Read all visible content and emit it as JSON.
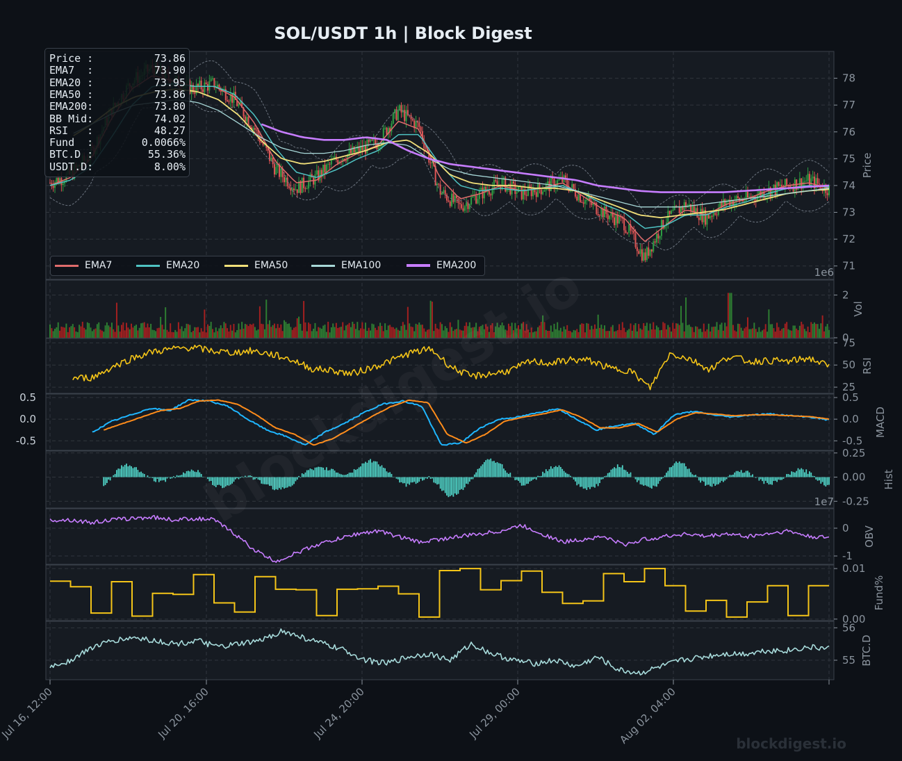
{
  "title": "SOL/USDT  1h  |  Block Digest",
  "watermark": "blockdigest.io",
  "footer_brand": "blockdigest.io",
  "info": [
    {
      "label": "Price :",
      "value": "73.86"
    },
    {
      "label": "EMA7  :",
      "value": "73.90"
    },
    {
      "label": "EMA20 :",
      "value": "73.95"
    },
    {
      "label": "EMA50 :",
      "value": "73.86"
    },
    {
      "label": "EMA200:",
      "value": "73.80"
    },
    {
      "label": "BB Mid:",
      "value": "74.02"
    },
    {
      "label": "RSI   :",
      "value": "48.27"
    },
    {
      "label": "Fund  :",
      "value": "0.0066%"
    },
    {
      "label": "BTC.D :",
      "value": "55.36%"
    },
    {
      "label": "USDT.D:",
      "value": "8.00%"
    }
  ],
  "legend": [
    {
      "name": "EMA7",
      "color": "#e06c6c"
    },
    {
      "name": "EMA20",
      "color": "#4fc3c3"
    },
    {
      "name": "EMA50",
      "color": "#f2e07a"
    },
    {
      "name": "EMA100",
      "color": "#a8d8d8"
    },
    {
      "name": "EMA200",
      "color": "#c77dff"
    }
  ],
  "colors": {
    "background": "#0d1117",
    "panel": "#161b22",
    "up": "#2ea043",
    "down": "#e05555",
    "rsi": "#f5c518",
    "macd": "#1fb6ff",
    "signal": "#ff8c1a",
    "hist": "#4fd1c5",
    "obv": "#c77dff",
    "fund": "#f5c518",
    "btcd": "#a8dcdc",
    "grid": "#30363d"
  },
  "chart_data": {
    "type": "line",
    "symbol": "SOL/USDT",
    "interval": "1h",
    "x_ticks": [
      "Jul 16, 12:00",
      "Jul 20, 16:00",
      "Jul 24, 20:00",
      "Jul 29, 00:00",
      "Aug 02, 04:00"
    ],
    "x_range": [
      "Jul 16, 12:00",
      "Aug 06, 08:00"
    ],
    "panels": [
      {
        "name": "price",
        "ylabel": "Price",
        "ylim": [
          70.5,
          79.0
        ],
        "yticks": [
          "71",
          "72",
          "73",
          "74",
          "75",
          "76",
          "77",
          "78"
        ],
        "series": [
          {
            "name": "Close",
            "values": [
              74.1,
              74.4,
              75.2,
              76.8,
              77.9,
              78.4,
              77.9,
              77.6,
              77.8,
              77.2,
              76.1,
              74.6,
              73.9,
              74.3,
              75.0,
              75.3,
              75.6,
              76.8,
              76.2,
              73.8,
              73.2,
              73.7,
              74.1,
              73.7,
              73.9,
              74.2,
              73.5,
              73.0,
              72.6,
              71.3,
              72.7,
              73.3,
              72.8,
              73.4,
              73.5,
              73.8,
              74.0,
              74.2,
              73.86
            ]
          },
          {
            "name": "EMA7",
            "values": [
              74.0,
              74.3,
              75.0,
              76.5,
              77.6,
              78.1,
              77.9,
              77.7,
              77.7,
              77.3,
              76.3,
              74.9,
              74.1,
              74.2,
              74.8,
              75.2,
              75.5,
              76.4,
              76.1,
              74.3,
              73.5,
              73.7,
              74.0,
              73.8,
              73.9,
              74.1,
              73.6,
              73.1,
              72.8,
              71.9,
              72.5,
              73.1,
              72.9,
              73.3,
              73.5,
              73.8,
              74.0,
              74.1,
              73.9
            ]
          },
          {
            "name": "EMA20",
            "values": [
              74.0,
              74.2,
              74.7,
              75.8,
              77.0,
              77.7,
              77.8,
              77.7,
              77.7,
              77.4,
              76.6,
              75.4,
              74.5,
              74.3,
              74.6,
              75.0,
              75.3,
              75.9,
              75.9,
              74.8,
              74.0,
              73.8,
              73.9,
              73.8,
              73.9,
              74.0,
              73.7,
              73.3,
              73.0,
              72.4,
              72.5,
              72.9,
              72.9,
              73.2,
              73.4,
              73.7,
              73.9,
              74.0,
              73.95
            ]
          },
          {
            "name": "EMA50",
            "values": [
              null,
              75.8,
              76.3,
              76.9,
              77.3,
              77.5,
              77.6,
              77.5,
              77.2,
              76.6,
              75.7,
              75.0,
              74.8,
              74.9,
              75.1,
              75.3,
              75.6,
              75.7,
              75.2,
              74.4,
              74.1,
              74.0,
              74.0,
              73.9,
              73.9,
              73.8,
              73.5,
              73.2,
              72.9,
              72.8,
              72.9,
              73.0,
              73.1,
              73.3,
              73.5,
              73.7,
              73.8,
              73.86
            ]
          },
          {
            "name": "EMA100",
            "values": [
              null,
              75.9,
              76.3,
              76.7,
              77.0,
              77.1,
              77.2,
              77.1,
              76.8,
              76.3,
              75.8,
              75.4,
              75.2,
              75.2,
              75.3,
              75.5,
              75.6,
              75.5,
              75.0,
              74.6,
              74.4,
              74.3,
              74.2,
              74.1,
              74.0,
              73.8,
              73.6,
              73.4,
              73.2,
              73.2,
              73.2,
              73.3,
              73.4,
              73.5,
              73.6,
              73.7,
              73.8,
              73.9
            ]
          },
          {
            "name": "EMA200",
            "values": [
              null,
              null,
              null,
              null,
              null,
              null,
              null,
              null,
              null,
              null,
              76.3,
              76.0,
              75.8,
              75.7,
              75.7,
              75.8,
              75.7,
              75.3,
              75.0,
              74.8,
              74.7,
              74.6,
              74.5,
              74.4,
              74.3,
              74.2,
              74.0,
              73.9,
              73.8,
              73.75,
              73.75,
              73.75,
              73.75,
              73.8,
              73.85,
              73.9,
              73.95,
              74.0
            ]
          }
        ]
      },
      {
        "name": "volume",
        "ylabel": "Vol",
        "scale": "1e6",
        "ylim": [
          0,
          2.7
        ],
        "yticks": [
          "0",
          "2"
        ]
      },
      {
        "name": "rsi",
        "ylabel": "RSI",
        "ylim": [
          18,
          80
        ],
        "yticks": [
          "25",
          "50",
          "75"
        ],
        "values": [
          35,
          36,
          48,
          58,
          65,
          68,
          70,
          66,
          64,
          66,
          62,
          56,
          46,
          44,
          40,
          47,
          55,
          64,
          68,
          48,
          37,
          40,
          44,
          54,
          52,
          56,
          55,
          46,
          44,
          24,
          63,
          57,
          45,
          60,
          54,
          55,
          54,
          58,
          48.27
        ]
      },
      {
        "name": "macd",
        "ylabel": "MACD",
        "ylim": [
          -0.72,
          0.58
        ],
        "yticks_left": [
          "-0.5",
          "0.0",
          "0.5"
        ],
        "yticks_right": [
          "-0.5",
          "0.0",
          "0.5"
        ],
        "series": [
          {
            "name": "MACD",
            "values": [
              -0.3,
              -0.05,
              0.1,
              0.25,
              0.2,
              0.45,
              0.42,
              0.3,
              0.0,
              -0.25,
              -0.4,
              -0.6,
              -0.3,
              -0.1,
              0.15,
              0.35,
              0.42,
              0.3,
              -0.6,
              -0.55,
              -0.2,
              0.0,
              0.05,
              0.15,
              0.25,
              0.0,
              -0.25,
              -0.15,
              -0.1,
              -0.35,
              0.1,
              0.18,
              0.1,
              0.05,
              0.1,
              0.12,
              0.08,
              0.05,
              -0.02
            ]
          },
          {
            "name": "Signal",
            "values": [
              -0.25,
              -0.1,
              0.05,
              0.2,
              0.25,
              0.42,
              0.44,
              0.35,
              0.1,
              -0.2,
              -0.35,
              -0.6,
              -0.45,
              -0.2,
              0.05,
              0.28,
              0.44,
              0.38,
              -0.35,
              -0.55,
              -0.35,
              -0.05,
              0.05,
              0.12,
              0.22,
              0.05,
              -0.2,
              -0.2,
              -0.1,
              -0.3,
              0.0,
              0.15,
              0.12,
              0.08,
              0.1,
              0.1,
              0.08,
              0.06,
              0.0
            ]
          }
        ]
      },
      {
        "name": "hist",
        "ylabel": "Hist",
        "ylim": [
          -0.32,
          0.27
        ],
        "yticks": [
          "0.25",
          "0.00",
          "-0.25"
        ]
      },
      {
        "name": "obv",
        "ylabel": "OBV",
        "scale": "1e7",
        "ylim": [
          -1.3,
          0.7
        ],
        "yticks": [
          "0",
          "-1"
        ],
        "values": [
          0.3,
          0.3,
          0.2,
          0.3,
          0.35,
          0.4,
          0.3,
          0.35,
          0.3,
          -0.2,
          -0.8,
          -1.2,
          -0.9,
          -0.6,
          -0.4,
          -0.2,
          -0.1,
          -0.3,
          -0.5,
          -0.4,
          -0.3,
          -0.2,
          -0.1,
          0.1,
          -0.2,
          -0.5,
          -0.4,
          -0.3,
          -0.6,
          -0.4,
          -0.3,
          -0.2,
          -0.3,
          -0.2,
          -0.3,
          -0.2,
          -0.1,
          -0.3,
          -0.35
        ]
      },
      {
        "name": "funding",
        "ylabel": "Fund%",
        "ylim": [
          -0.0003,
          0.0107
        ],
        "yticks": [
          "0.00",
          "0.01"
        ],
        "values": [
          0.0075,
          0.0064,
          0.0012,
          0.0074,
          0.0006,
          0.0051,
          0.0049,
          0.0088,
          0.0032,
          0.0014,
          0.0084,
          0.0059,
          0.0058,
          0.0007,
          0.0059,
          0.006,
          0.0065,
          0.005,
          0.0004,
          0.0096,
          0.01,
          0.0058,
          0.0076,
          0.0095,
          0.0053,
          0.0031,
          0.0036,
          0.009,
          0.0074,
          0.01,
          0.0066,
          0.0016,
          0.0037,
          0.0004,
          0.0034,
          0.0066,
          0.0007,
          0.0066
        ]
      },
      {
        "name": "btc_dominance",
        "ylabel": "BTC.D",
        "ylim": [
          54.4,
          56.2
        ],
        "yticks": [
          "55",
          "56"
        ],
        "values": [
          54.8,
          55.0,
          55.4,
          55.6,
          55.7,
          55.6,
          55.5,
          55.6,
          55.4,
          55.5,
          55.6,
          55.9,
          55.7,
          55.5,
          55.3,
          55.0,
          54.9,
          55.1,
          55.2,
          55.0,
          55.5,
          55.2,
          55.0,
          54.9,
          55.0,
          54.8,
          55.1,
          54.7,
          54.6,
          54.8,
          55.0,
          55.1,
          55.2,
          55.2,
          55.3,
          55.3,
          55.4,
          55.36
        ]
      }
    ]
  }
}
